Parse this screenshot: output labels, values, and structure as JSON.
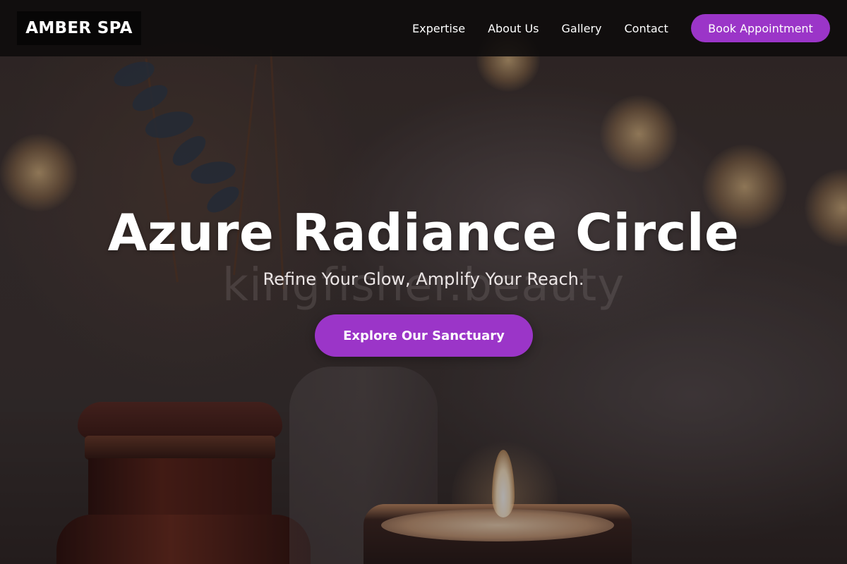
{
  "header": {
    "logo": "AMBER SPA",
    "nav": [
      {
        "label": "Expertise"
      },
      {
        "label": "About Us"
      },
      {
        "label": "Gallery"
      },
      {
        "label": "Contact"
      }
    ],
    "cta_label": "Book Appointment"
  },
  "hero": {
    "title": "Azure Radiance Circle",
    "subtitle": "Refine Your Glow, Amplify Your Reach.",
    "watermark": "kingfisher.beauty",
    "cta_label": "Explore Our Sanctuary",
    "background_image": "candle-and-jar-spa-photo"
  },
  "colors": {
    "accent": "#9b35c8",
    "header_bg": "#0e0c0c",
    "text": "#ffffff"
  }
}
